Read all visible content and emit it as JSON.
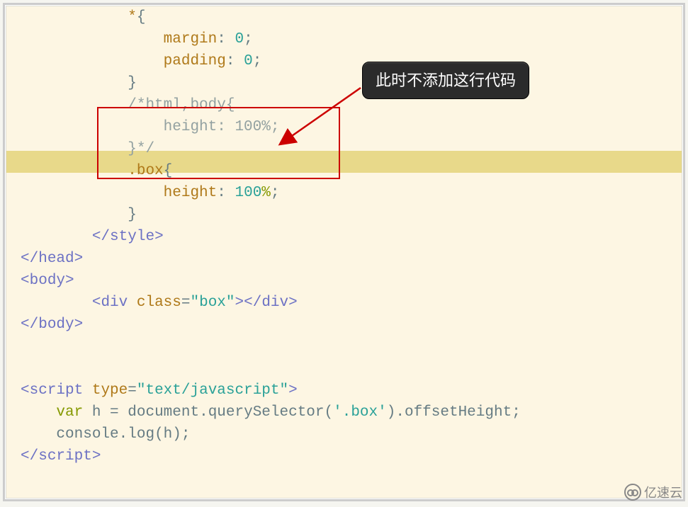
{
  "callout": {
    "text": "此时不添加这行代码"
  },
  "watermark": {
    "text": "亿速云"
  },
  "code": {
    "line1_indent": "            ",
    "line1_a": "*",
    "line1_b": "{",
    "line2_indent": "                ",
    "line2_a": "margin",
    "line2_b": ": ",
    "line2_c": "0",
    "line2_d": ";",
    "line3_indent": "                ",
    "line3_a": "padding",
    "line3_b": ": ",
    "line3_c": "0",
    "line3_d": ";",
    "line4_indent": "            ",
    "line4_a": "}",
    "line5_indent": "            ",
    "line5_a": "/*html,body{",
    "line6_indent": "                ",
    "line6_a": "height: 100%;",
    "line7_indent": "            ",
    "line7_a": "}*/",
    "line8_indent": "            ",
    "line8_a": ".box",
    "line8_b": "{",
    "line9_indent": "                ",
    "line9_a": "height",
    "line9_b": ": ",
    "line9_c": "100",
    "line9_d": "%",
    "line9_e": ";",
    "line10_indent": "            ",
    "line10_a": "}",
    "line11_indent": "        ",
    "line11_a": "</",
    "line11_b": "style",
    "line11_c": ">",
    "line12_a": "</",
    "line12_b": "head",
    "line12_c": ">",
    "line13_a": "<",
    "line13_b": "body",
    "line13_c": ">",
    "line14_indent": "        ",
    "line14_a": "<",
    "line14_b": "div",
    "line14_c": " ",
    "line14_d": "class",
    "line14_e": "=",
    "line14_f": "\"box\"",
    "line14_g": "></",
    "line14_h": "div",
    "line14_i": ">",
    "line15_a": "</",
    "line15_b": "body",
    "line15_c": ">",
    "line16_a": "<",
    "line16_b": "script",
    "line16_c": " ",
    "line16_d": "type",
    "line16_e": "=",
    "line16_f": "\"text/javascript\"",
    "line16_g": ">",
    "line17_indent": "    ",
    "line17_a": "var",
    "line17_b": " h ",
    "line17_c": "=",
    "line17_d": " document",
    "line17_e": ".",
    "line17_f": "querySelector",
    "line17_g": "(",
    "line17_h": "'.box'",
    "line17_i": ")",
    "line17_j": ".",
    "line17_k": "offsetHeight",
    "line17_l": ";",
    "line18_indent": "    ",
    "line18_a": "console",
    "line18_b": ".",
    "line18_c": "log",
    "line18_d": "(",
    "line18_e": "h",
    "line18_f": ")",
    "line18_g": ";",
    "line19_a": "</",
    "line19_b": "script",
    "line19_c": ">"
  }
}
